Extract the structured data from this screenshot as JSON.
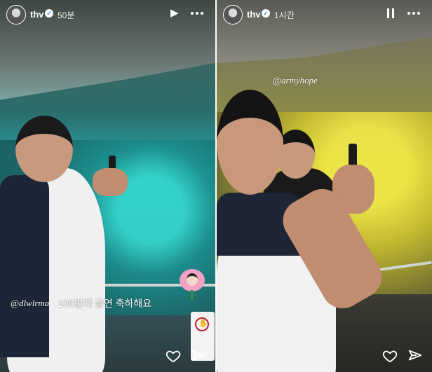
{
  "stories": [
    {
      "username": "thv",
      "time": "50분",
      "header_action": "play",
      "mention": "@dlwlrma",
      "caption": "100번째 공연 축하해요",
      "sticker": "flower-face-sticker",
      "sign": "no-entry-sign",
      "footer": {
        "like": "heart-icon",
        "share": "send-icon"
      }
    },
    {
      "username": "thv",
      "time": "1시간",
      "header_action": "pause",
      "mention": "@armyhope",
      "footer": {
        "like": "heart-icon",
        "share": "send-icon"
      }
    }
  ],
  "colors": {
    "verified": "#3897f0",
    "text": "#ffffff",
    "left_lights": "#2ad1c8",
    "right_lights": "#e9e243"
  }
}
